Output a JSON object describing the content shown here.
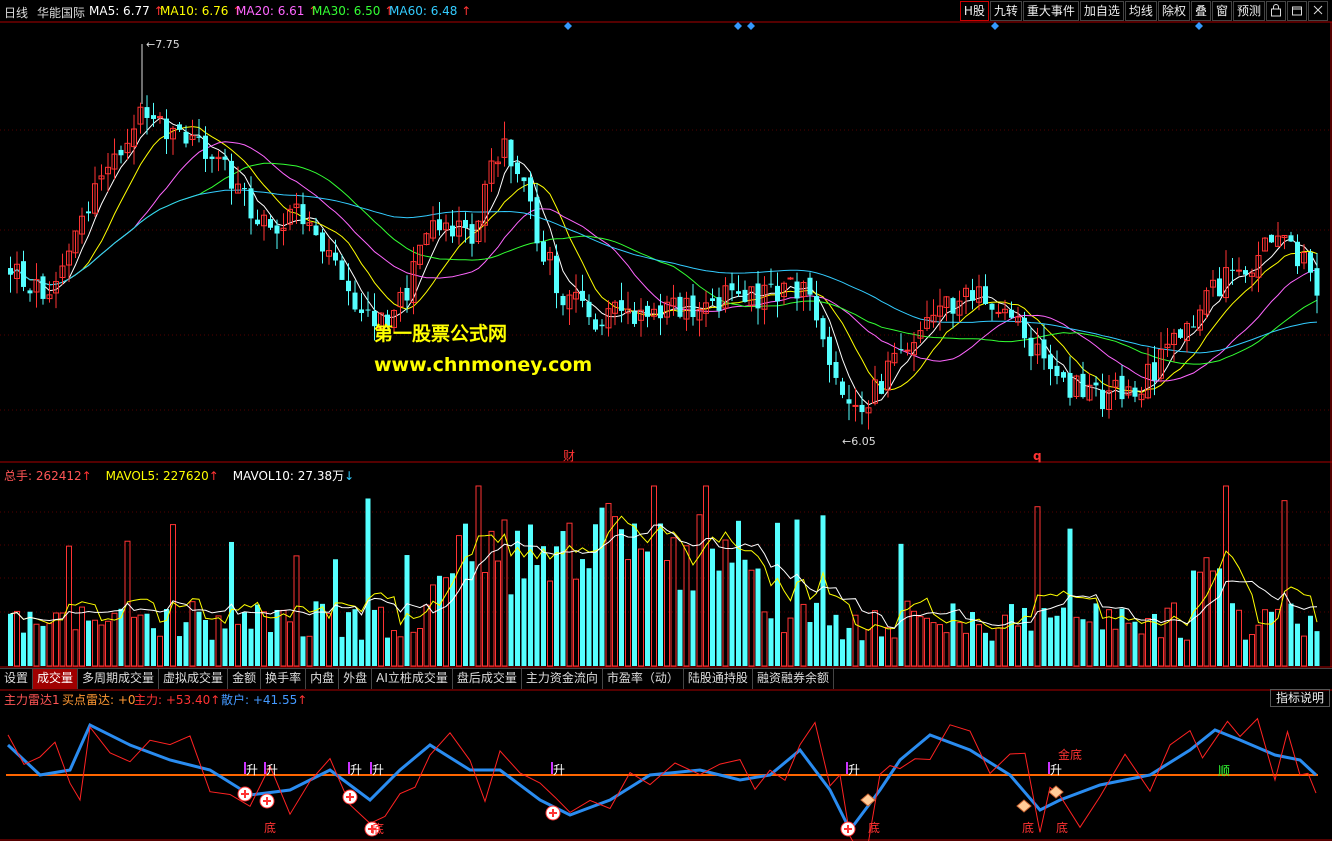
{
  "header": {
    "period": "日线",
    "stock_name": "华能国际",
    "ma": [
      {
        "label": "MA5: 6.77",
        "color": "#ffffff",
        "arrow": "↑"
      },
      {
        "label": "MA10: 6.76",
        "color": "#ffff00",
        "arrow": "↑"
      },
      {
        "label": "MA20: 6.61",
        "color": "#ff66ff",
        "arrow": "↑"
      },
      {
        "label": "MA30: 6.50",
        "color": "#33ff33",
        "arrow": "↑"
      },
      {
        "label": "MA60: 6.48",
        "color": "#33ccff",
        "arrow": "↑"
      }
    ]
  },
  "right_buttons": [
    "H股",
    "九转",
    "重大事件",
    "加自选",
    "均线",
    "除权",
    "叠",
    "窗",
    "预测"
  ],
  "icons": {
    "lock": "lock-icon",
    "restore": "restore-icon",
    "close": "close-icon"
  },
  "price_chart": {
    "high_label": "7.75",
    "low_label": "6.05",
    "marker_cai": "财",
    "marker_q": "q"
  },
  "watermark": {
    "line1": "第一股票公式网",
    "line2": "www.chnmoney.com"
  },
  "volume_header": {
    "total_label": "总手: 262412",
    "mavol5_label": "MAVOL5: 227620",
    "mavol10_label": "MAVOL10: 27.38万",
    "arrow_up": "↑",
    "arrow_down": "↓"
  },
  "tabs": [
    "设置",
    "成交量",
    "多周期成交量",
    "虚拟成交量",
    "金额",
    "换手率",
    "内盘",
    "外盘",
    "AI立桩成交量",
    "盘后成交量",
    "主力资金流向",
    "市盈率（动）",
    "陆股通持股",
    "融资融券余额"
  ],
  "selected_tab": "成交量",
  "indicator_header": {
    "name": "主力雷达1",
    "buy_label": "买点雷达: +0",
    "main_label": "主力: +53.40",
    "retail_label": "散户: +41.55",
    "arrow_up": "↑"
  },
  "indicator_help": "指标说明",
  "indicator_marks": {
    "sheng": "升",
    "di": "底",
    "jindi": "金底",
    "shun": "顺"
  },
  "colors": {
    "up": "#ff3333",
    "down": "#55ffff",
    "grid": "#8b0000",
    "zero_line": "#ff6600",
    "retail_line": "#2a8cf0"
  }
}
